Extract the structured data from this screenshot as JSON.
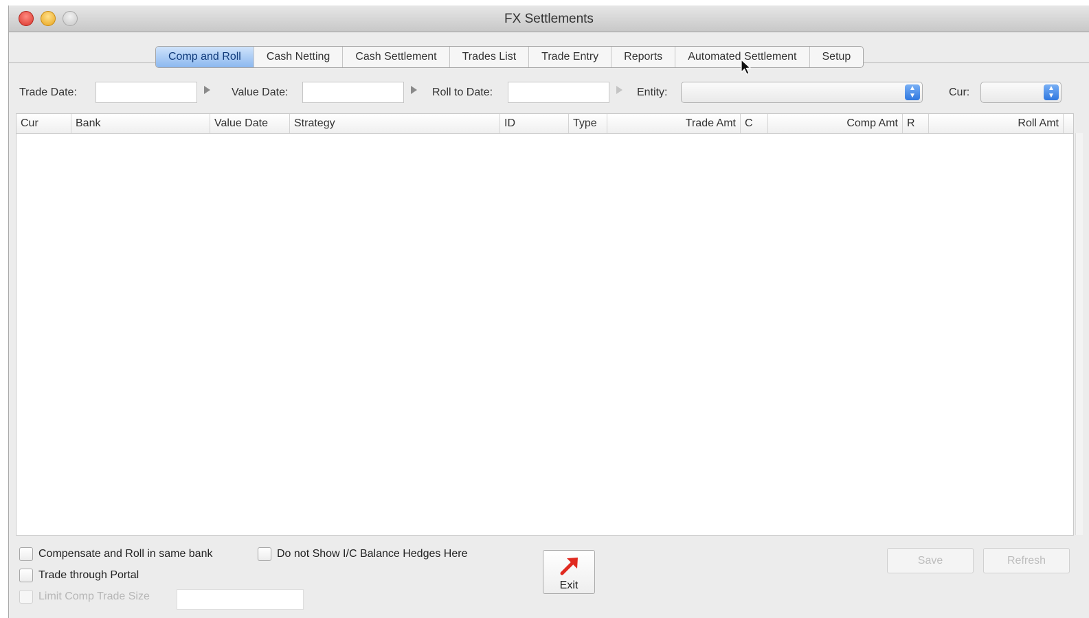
{
  "window": {
    "title": "FX Settlements"
  },
  "tabs": [
    {
      "label": "Comp and Roll",
      "active": true
    },
    {
      "label": "Cash Netting"
    },
    {
      "label": "Cash Settlement"
    },
    {
      "label": "Trades List"
    },
    {
      "label": "Trade Entry"
    },
    {
      "label": "Reports"
    },
    {
      "label": "Automated Settlement"
    },
    {
      "label": "Setup"
    }
  ],
  "filters": {
    "trade_date_label": "Trade Date:",
    "trade_date_value": "",
    "value_date_label": "Value Date:",
    "value_date_value": "",
    "roll_to_date_label": "Roll to Date:",
    "roll_to_date_value": "",
    "entity_label": "Entity:",
    "entity_value": "",
    "cur_label": "Cur:",
    "cur_value": ""
  },
  "table": {
    "columns": [
      "Cur",
      "Bank",
      "Value Date",
      "Strategy",
      "ID",
      "Type",
      "Trade Amt",
      "C",
      "Comp Amt",
      "R",
      "Roll Amt"
    ],
    "rows": []
  },
  "options": {
    "compensate_roll_label": "Compensate and Roll in same bank",
    "compensate_roll_checked": false,
    "no_ic_balance_label": "Do not Show I/C Balance Hedges Here",
    "no_ic_balance_checked": false,
    "trade_portal_label": "Trade through Portal",
    "trade_portal_checked": false,
    "limit_comp_label": "Limit Comp Trade Size",
    "limit_comp_checked": false,
    "limit_comp_value": ""
  },
  "buttons": {
    "exit": "Exit",
    "save": "Save",
    "refresh": "Refresh"
  },
  "colors": {
    "active_tab": "#8cb8ef",
    "exit_arrow": "#e02a20",
    "select_stepper": "#2f77df"
  }
}
